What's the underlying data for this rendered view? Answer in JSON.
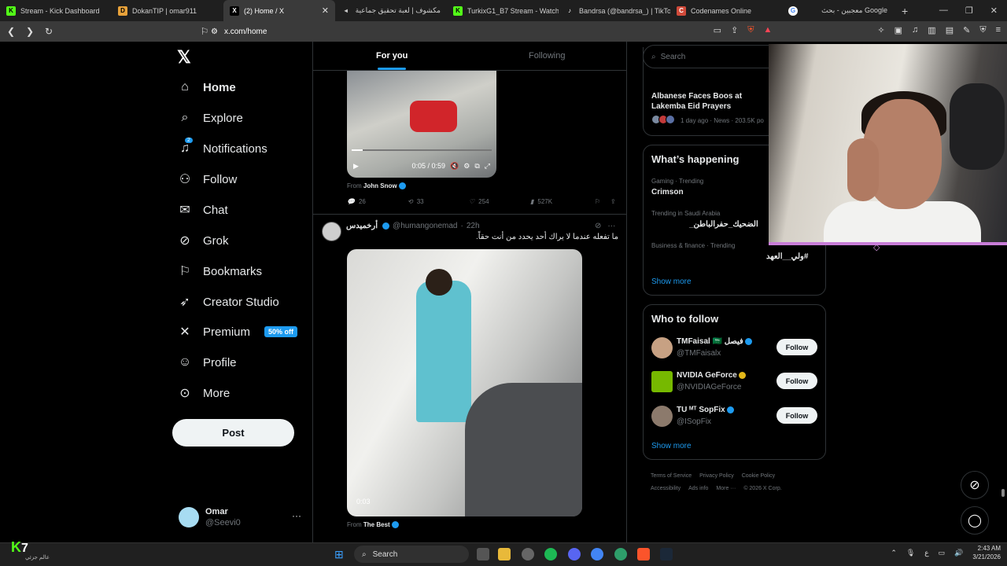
{
  "browser": {
    "tabs": [
      {
        "title": "Stream - Kick Dashboard",
        "fav_color": "#53fc18",
        "fav_glyph": "K"
      },
      {
        "title": "DokanTIP | omar911",
        "fav_color": "#e8a23a",
        "fav_glyph": "D"
      },
      {
        "title": "(2) Home / X",
        "fav_color": "#000000",
        "fav_glyph": "X"
      },
      {
        "title": "مكشوف | لعبة تحقيق جماعية",
        "fav_color": "#2a2a2a",
        "fav_glyph": "◂"
      },
      {
        "title": "TurkixG1_B7 Stream - Watch Li",
        "fav_color": "#53fc18",
        "fav_glyph": "K"
      },
      {
        "title": "Bandrsa (@bandrsa_) | TikTok",
        "fav_color": "#111111",
        "fav_glyph": "♪"
      },
      {
        "title": "Codenames Online",
        "fav_color": "#d04a3a",
        "fav_glyph": "C"
      },
      {
        "title": "معجبين - بحث Google",
        "fav_color": "#ffffff",
        "fav_glyph": "G"
      }
    ],
    "url": "x.com/home"
  },
  "x": {
    "nav": [
      {
        "label": "Home",
        "icon": "home-icon",
        "glyph": "⌂"
      },
      {
        "label": "Explore",
        "icon": "search-icon",
        "glyph": "⌕"
      },
      {
        "label": "Notifications",
        "icon": "bell-icon",
        "glyph": "🔔"
      },
      {
        "label": "Follow",
        "icon": "add-person-icon",
        "glyph": "⚇"
      },
      {
        "label": "Chat",
        "icon": "mail-icon",
        "glyph": "✉"
      },
      {
        "label": "Grok",
        "icon": "grok-icon",
        "glyph": "⊘"
      },
      {
        "label": "Bookmarks",
        "icon": "bookmark-icon",
        "glyph": "⚑"
      },
      {
        "label": "Creator Studio",
        "icon": "rocket-icon",
        "glyph": "➶"
      },
      {
        "label": "Premium",
        "icon": "x-logo-icon",
        "glyph": "𝕏"
      },
      {
        "label": "Profile",
        "icon": "person-icon",
        "glyph": "☺"
      },
      {
        "label": "More",
        "icon": "more-circle-icon",
        "glyph": "⋯"
      }
    ],
    "notif_count": "2",
    "premium_badge": "50% off",
    "post_button": "Post",
    "account": {
      "name": "Omar",
      "handle": "@Seevi0"
    },
    "feed_tabs": {
      "for_you": "For you",
      "following": "Following"
    },
    "post1": {
      "time": "0:05 / 0:59",
      "from_label": "From",
      "from": "John Snow",
      "replies": "26",
      "reposts": "33",
      "likes": "254",
      "views": "527K"
    },
    "post2": {
      "name": "أرخميدس",
      "handle": "@humangonemad",
      "age": "22h",
      "text": "ما تفعله عندما لا يراك أحد يحدد من أنت حقاً.",
      "video_time": "0:03",
      "from_label": "From",
      "from": "The Best"
    },
    "search_placeholder": "Search",
    "news": {
      "title": "Albanese Faces Boos at Lakemba Eid Prayers",
      "meta": "1 day ago · News · 203.5K po"
    },
    "happening": {
      "title": "What’s happening",
      "trends": [
        {
          "context": "Gaming · Trending",
          "name": "Crimson"
        },
        {
          "context": "Trending in Saudi Arabia",
          "name": "الضحيك_حفرالباطن_"
        },
        {
          "context": "Business & finance · Trending",
          "name": "#ولي__العهد"
        }
      ],
      "show_more": "Show more"
    },
    "who_to_follow": {
      "title": "Who to follow",
      "people": [
        {
          "name": "TMFaisal 🇸🇦 فيصل",
          "handle": "@TMFaisalx",
          "avatar": "#c7a183",
          "button": "Follow"
        },
        {
          "name": "NVIDIA GeForce",
          "handle": "@NVIDIAGeForce",
          "avatar": "#76b900",
          "button": "Follow"
        },
        {
          "name": "TU ᴹᵀ SopFix",
          "handle": "@ISopFix",
          "avatar": "#8c7a6c",
          "button": "Follow"
        }
      ],
      "show_more": "Show more"
    },
    "footer": [
      "Terms of Service",
      "Privacy Policy",
      "Cookie Policy",
      "Accessibility",
      "Ads info",
      "More ···",
      "© 2026 X Corp."
    ]
  },
  "taskbar": {
    "search": "Search",
    "kick_number": "7",
    "kick_sub": "عالم جزئي",
    "time": "2:43 AM",
    "date": "3/21/2026"
  },
  "accent": "#1d9bf0"
}
